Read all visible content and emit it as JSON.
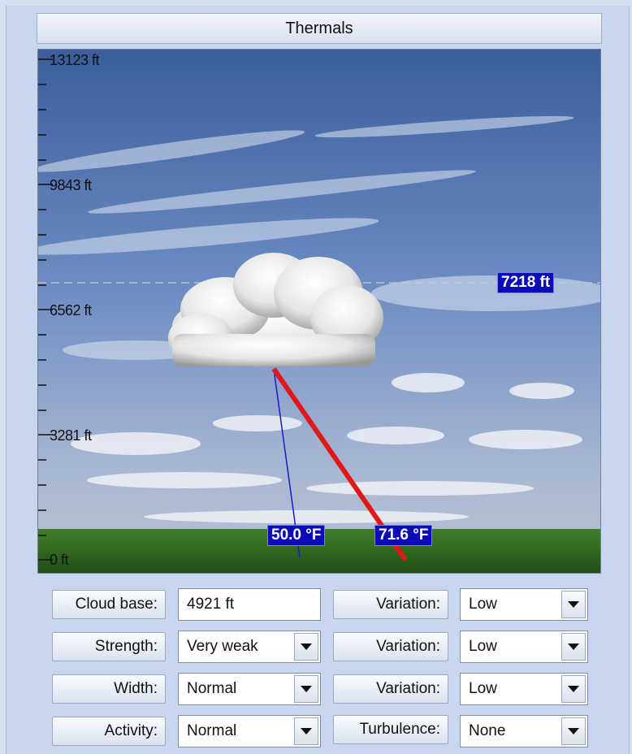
{
  "header": {
    "title": "Thermals"
  },
  "altitude_scale": {
    "labels": [
      "13123 ft",
      "9843 ft",
      "6562 ft",
      "3281 ft",
      "0 ft"
    ]
  },
  "cloud_top_readout": "7218 ft",
  "temperature_readouts": {
    "left": "50.0 °F",
    "right": "71.6 °F"
  },
  "controls": {
    "cloud_base": {
      "label": "Cloud base:",
      "value": "4921 ft"
    },
    "strength": {
      "label": "Strength:",
      "value": "Very weak"
    },
    "width": {
      "label": "Width:",
      "value": "Normal"
    },
    "activity": {
      "label": "Activity:",
      "value": "Normal"
    },
    "variation_1": {
      "label": "Variation:",
      "value": "Low"
    },
    "variation_2": {
      "label": "Variation:",
      "value": "Low"
    },
    "variation_3": {
      "label": "Variation:",
      "value": "Low"
    },
    "turbulence": {
      "label": "Turbulence:",
      "value": "None"
    }
  },
  "colors": {
    "readout_bg": "#0b0bb8",
    "dry_line": "#e01818",
    "dew_line": "#1a1ad0",
    "ground": "#2f6b1e"
  }
}
